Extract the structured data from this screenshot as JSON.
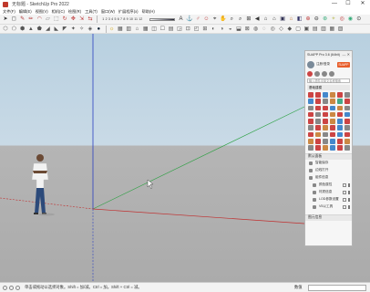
{
  "titlebar": {
    "title": "无标题 - SketchUp Pro 2022",
    "minimize": "—",
    "maximize": "☐",
    "close": "✕"
  },
  "menubar": {
    "items": [
      "文件(F)",
      "编辑(E)",
      "视图(V)",
      "相机(C)",
      "绘图(R)",
      "工具(T)",
      "窗口(W)",
      "扩展程序(x)",
      "帮助(H)"
    ]
  },
  "toolbar": {
    "scale_values": [
      "1",
      "2",
      "3",
      "4",
      "5",
      "6",
      "7",
      "8",
      "9",
      "10",
      "11",
      "12"
    ],
    "row1_left_tools": [
      {
        "glyph": "➤",
        "color": "#333"
      },
      {
        "glyph": "◻",
        "color": "#333"
      },
      {
        "glyph": "✎",
        "color": "#b03030"
      },
      {
        "glyph": "✏",
        "color": "#b03030"
      },
      {
        "glyph": "◠",
        "color": "#b03030"
      },
      {
        "glyph": "▱",
        "color": "#666"
      },
      {
        "glyph": "⬚",
        "color": "#666"
      },
      {
        "glyph": "↻",
        "color": "#c04040"
      },
      {
        "glyph": "✥",
        "color": "#c04040"
      },
      {
        "glyph": "⇲",
        "color": "#c04040"
      },
      {
        "glyph": "⇆",
        "color": "#c04040"
      }
    ],
    "row1_right_tools": [
      {
        "glyph": "A",
        "color": "#333"
      },
      {
        "glyph": "⚓",
        "color": "#333"
      },
      {
        "glyph": "♂",
        "color": "#b03030"
      },
      {
        "glyph": "☺",
        "color": "#c04040"
      },
      {
        "glyph": "⌖",
        "color": "#333"
      },
      {
        "glyph": "✋",
        "color": "#c08040"
      },
      {
        "glyph": "⌕",
        "color": "#333"
      },
      {
        "glyph": "⌕",
        "color": "#333"
      },
      {
        "glyph": "⊞",
        "color": "#333"
      },
      {
        "glyph": "◀",
        "color": "#333"
      },
      {
        "glyph": "⌂",
        "color": "#333"
      },
      {
        "glyph": "⌂",
        "color": "#333"
      },
      {
        "glyph": "▣",
        "color": "#335"
      },
      {
        "glyph": "⌂",
        "color": "#c07030"
      },
      {
        "glyph": "◧",
        "color": "#336"
      },
      {
        "glyph": "⊕",
        "color": "#c04040"
      },
      {
        "glyph": "⊖",
        "color": "#333"
      },
      {
        "glyph": "⊛",
        "color": "#3a7"
      },
      {
        "glyph": "✦",
        "color": "#cc8"
      },
      {
        "glyph": "◎",
        "color": "#c04040"
      },
      {
        "glyph": "◉",
        "color": "#3a7"
      },
      {
        "glyph": "⊙",
        "color": "#333"
      }
    ],
    "row2_left_tools": [
      {
        "glyph": "⬡",
        "color": "#555"
      },
      {
        "glyph": "⬠",
        "color": "#555"
      },
      {
        "glyph": "⬢",
        "color": "#555"
      },
      {
        "glyph": "▲",
        "color": "#555"
      },
      {
        "glyph": "⬟",
        "color": "#555"
      },
      {
        "glyph": "◢",
        "color": "#555"
      },
      {
        "glyph": "◣",
        "color": "#555"
      },
      {
        "glyph": "◤",
        "color": "#555"
      },
      {
        "glyph": "✦",
        "color": "#555"
      },
      {
        "glyph": "✧",
        "color": "#555"
      },
      {
        "glyph": "◈",
        "color": "#555"
      },
      {
        "glyph": "●",
        "color": "#123"
      }
    ],
    "row2_right_tools": [
      {
        "glyph": "☼",
        "color": "#d0a000"
      },
      {
        "glyph": "▦",
        "color": "#555"
      },
      {
        "glyph": "▥",
        "color": "#555"
      },
      {
        "glyph": "⌂",
        "color": "#555"
      },
      {
        "glyph": "▦",
        "color": "#555"
      },
      {
        "glyph": "◫",
        "color": "#555"
      },
      {
        "glyph": "☐",
        "color": "#555"
      },
      {
        "glyph": "▤",
        "color": "#555"
      },
      {
        "glyph": "◲",
        "color": "#555"
      },
      {
        "glyph": "⊡",
        "color": "#555"
      },
      {
        "glyph": "◰",
        "color": "#555"
      },
      {
        "glyph": "⊞",
        "color": "#555"
      },
      {
        "glyph": "◐",
        "color": "#555"
      },
      {
        "glyph": "◑",
        "color": "#555"
      },
      {
        "glyph": "◒",
        "color": "#555"
      },
      {
        "glyph": "⬓",
        "color": "#555"
      },
      {
        "glyph": "⊠",
        "color": "#555"
      },
      {
        "glyph": "◍",
        "color": "#555"
      },
      {
        "glyph": "◌",
        "color": "#555"
      },
      {
        "glyph": "◎",
        "color": "#555"
      },
      {
        "glyph": "◇",
        "color": "#555"
      },
      {
        "glyph": "◆",
        "color": "#555"
      },
      {
        "glyph": "▢",
        "color": "#555"
      },
      {
        "glyph": "▣",
        "color": "#555"
      },
      {
        "glyph": "▤",
        "color": "#555"
      },
      {
        "glyph": "▥",
        "color": "#555"
      },
      {
        "glyph": "▦",
        "color": "#555"
      },
      {
        "glyph": "▧",
        "color": "#555"
      }
    ]
  },
  "tray": {
    "title": "SUAPP Pro 3.6 (64bit)",
    "plugin": {
      "name": "注册/登录",
      "badge": "SUAPP",
      "search_placeholder": "输入插件中英文名称搜索",
      "category": "基础建模",
      "icon_colors": [
        "#c44",
        "#c44",
        "#48c",
        "#c84",
        "#c44",
        "#888",
        "#48c",
        "#c44",
        "#888",
        "#c84",
        "#4a8",
        "#c44",
        "#888",
        "#c44",
        "#c44",
        "#48c",
        "#c84",
        "#888",
        "#c44",
        "#888",
        "#c44",
        "#c84",
        "#c44",
        "#48c",
        "#c44",
        "#888",
        "#c44",
        "#c84",
        "#48c",
        "#c44",
        "#888",
        "#c44",
        "#c84",
        "#c44",
        "#48c",
        "#888",
        "#c44",
        "#c84",
        "#888",
        "#c44",
        "#48c",
        "#c44",
        "#c84",
        "#c44",
        "#888",
        "#48c",
        "#c44",
        "#c84",
        "#888",
        "#c44",
        "#c84",
        "#48c",
        "#c44",
        "#888"
      ]
    },
    "sections": [
      {
        "label": "默认面板"
      },
      {
        "label": "图元信息"
      }
    ],
    "rows": [
      {
        "label": "智能保存",
        "indent": false,
        "box": false
      },
      {
        "label": "边线打开",
        "indent": false,
        "box": false
      },
      {
        "label": "组件信息",
        "indent": false,
        "box": false
      },
      {
        "label": "颜色属性",
        "indent": true,
        "box": true
      },
      {
        "label": "材质信息",
        "indent": true,
        "box": true
      },
      {
        "label": "LOD参数设置",
        "indent": true,
        "box": true
      },
      {
        "label": "V5以工具",
        "indent": true,
        "box": true
      }
    ]
  },
  "statusbar": {
    "hint": "单击或拖动以选择对象。Shift = 加/减。Ctrl = 加。Shift + Ctrl = 减。",
    "measure_label": "数值"
  }
}
